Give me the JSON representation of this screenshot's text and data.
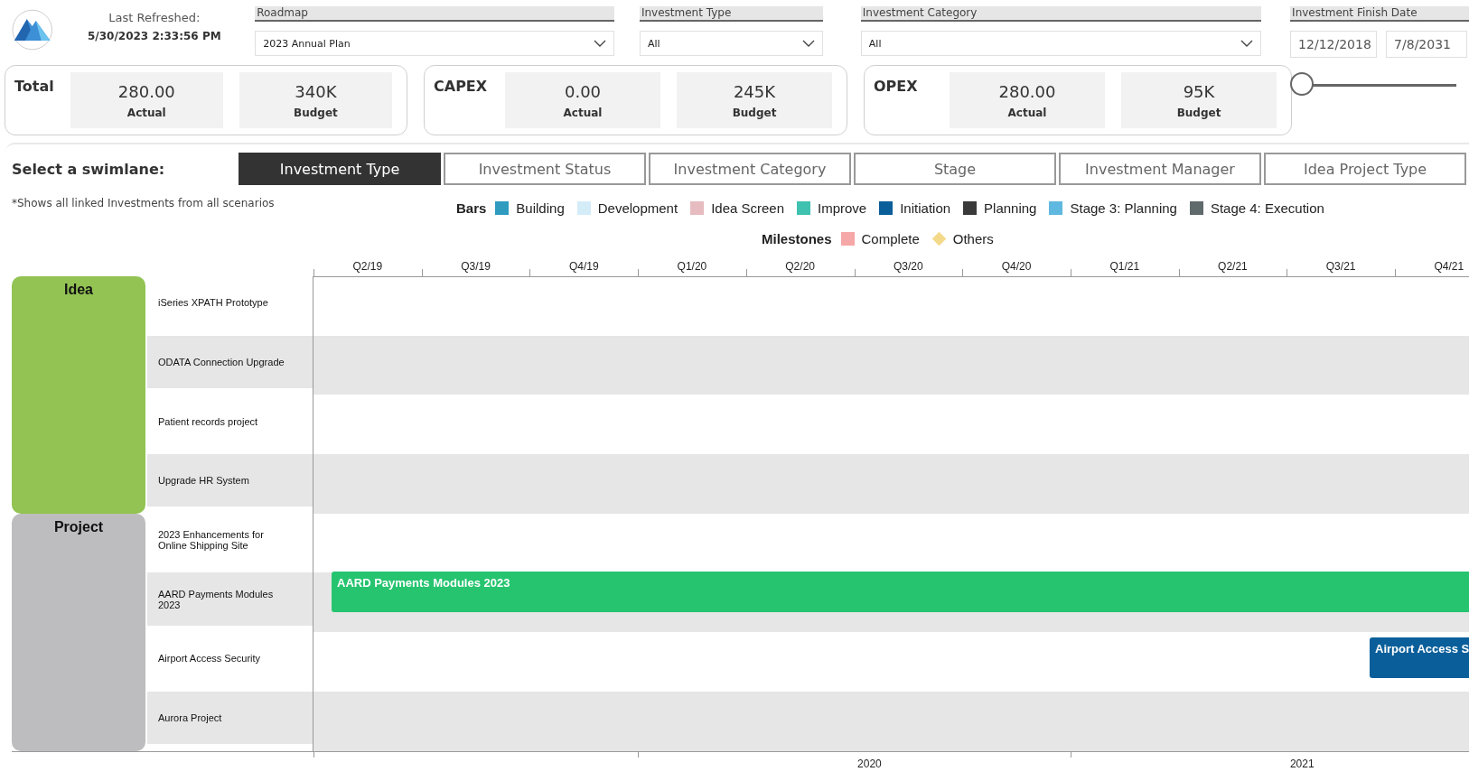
{
  "last_refreshed": {
    "label": "Last Refreshed:",
    "value": "5/30/2023 2:33:56 PM"
  },
  "filters": [
    {
      "kind": "dropdown",
      "label": "Roadmap",
      "value": "2023 Annual Plan"
    },
    {
      "kind": "dropdown",
      "label": "Investment Type",
      "value": "All"
    },
    {
      "kind": "dropdown",
      "label": "Investment Category",
      "value": "All"
    },
    {
      "kind": "date_range",
      "label": "Investment Finish Date",
      "from": "12/12/2018",
      "to": "7/8/2031",
      "level": 0
    }
  ],
  "kpi_cards": [
    {
      "title": "Total",
      "tiles": [
        {
          "value": "280.00",
          "label": "Actual"
        },
        {
          "value": "340K",
          "label": "Budget"
        }
      ]
    },
    {
      "title": "CAPEX",
      "tiles": [
        {
          "value": "0.00",
          "label": "Actual"
        },
        {
          "value": "245K",
          "label": "Budget"
        }
      ]
    },
    {
      "title": "OPEX",
      "tiles": [
        {
          "value": "280.00",
          "label": "Actual"
        },
        {
          "value": "95K",
          "label": "Budget"
        }
      ]
    }
  ],
  "swimlane": {
    "label": "Select a swimlane:",
    "tabs": [
      {
        "label": "Investment Type",
        "selected": true
      },
      {
        "label": "Investment Status",
        "selected": false
      },
      {
        "label": "Investment Category",
        "selected": false
      },
      {
        "label": "Stage",
        "selected": false
      },
      {
        "label": "Investment Manager",
        "selected": false
      },
      {
        "label": "Idea Project Type",
        "selected": false
      }
    ]
  },
  "note": "*Shows all linked Investments from all scenarios",
  "legend": {
    "bars_title": "Bars",
    "bars": [
      {
        "label": "Building",
        "color": "#2e9bbf"
      },
      {
        "label": "Development",
        "color": "#d3ecf8"
      },
      {
        "label": "Idea Screen",
        "color": "#e6bcc0"
      },
      {
        "label": "Improve",
        "color": "#3fc1b0"
      },
      {
        "label": "Initiation",
        "color": "#0a5f9a"
      },
      {
        "label": "Planning",
        "color": "#3a3a3a"
      },
      {
        "label": "Stage 3: Planning",
        "color": "#5fb8e0"
      },
      {
        "label": "Stage 4: Execution",
        "color": "#5f6a6c"
      }
    ],
    "milestones_title": "Milestones",
    "milestones": [
      {
        "kind": "square",
        "label": "Complete",
        "color": "#f6a7a7"
      },
      {
        "kind": "diamond",
        "label": "Others",
        "color": "#f5d98a"
      }
    ]
  },
  "timeline": {
    "quarters": [
      "Q2/19",
      "Q3/19",
      "Q4/19",
      "Q1/20",
      "Q2/20",
      "Q3/20",
      "Q4/20",
      "Q1/21",
      "Q2/21",
      "Q3/21",
      "Q4/21"
    ],
    "years": [
      "2020",
      "2021"
    ],
    "groups": [
      {
        "label": "Idea",
        "color": "#92c353",
        "rows": [
          {
            "name": "iSeries XPATH Prototype"
          },
          {
            "name": "ODATA Connection Upgrade"
          },
          {
            "name": "Patient records project"
          },
          {
            "name": "Upgrade HR System"
          }
        ]
      },
      {
        "label": "Project",
        "color": "#bdbdbf",
        "rows": [
          {
            "name": "2023 Enhancements for Online Shipping Site"
          },
          {
            "name": "AARD Payments Modules 2023",
            "bar": {
              "label": "AARD Payments Modules 2023",
              "color": "#26c46f"
            }
          },
          {
            "name": "Airport Access Security",
            "bar": {
              "label": "Airport Access S",
              "color": "#0a5f9a"
            }
          },
          {
            "name": "Aurora Project"
          }
        ]
      }
    ]
  }
}
